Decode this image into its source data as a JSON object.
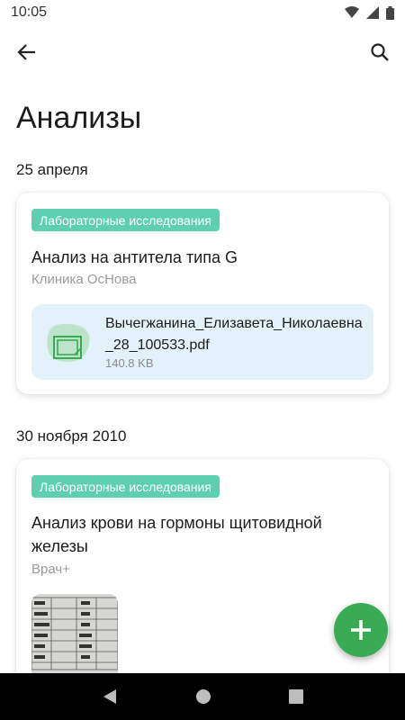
{
  "status_bar": {
    "time": "10:05"
  },
  "header": {
    "title": "Анализы"
  },
  "sections": [
    {
      "date": "25 апреля",
      "record": {
        "badge": "Лабораторные исследования",
        "title": "Анализ на антитела типа G",
        "subtitle": "Клиника ОсНова",
        "file": {
          "name": "Вычегжанина_Елизавета_Николаевна_28_100533.pdf",
          "size": "140.8 KB"
        }
      }
    },
    {
      "date": "30 ноября 2010",
      "record": {
        "badge": "Лабораторные исследования",
        "title": "Анализ крови на гормоны щитовидной железы",
        "subtitle": "Врач+"
      }
    }
  ],
  "colors": {
    "badge": "#5fcfb1",
    "fab": "#3aab55",
    "file_box": "#e3f1fa"
  },
  "icons": [
    "back-arrow-icon",
    "search-icon",
    "wifi-icon",
    "signal-icon",
    "battery-icon",
    "pdf-file-icon",
    "add-icon",
    "nav-back-icon",
    "nav-home-icon",
    "nav-recents-icon"
  ]
}
